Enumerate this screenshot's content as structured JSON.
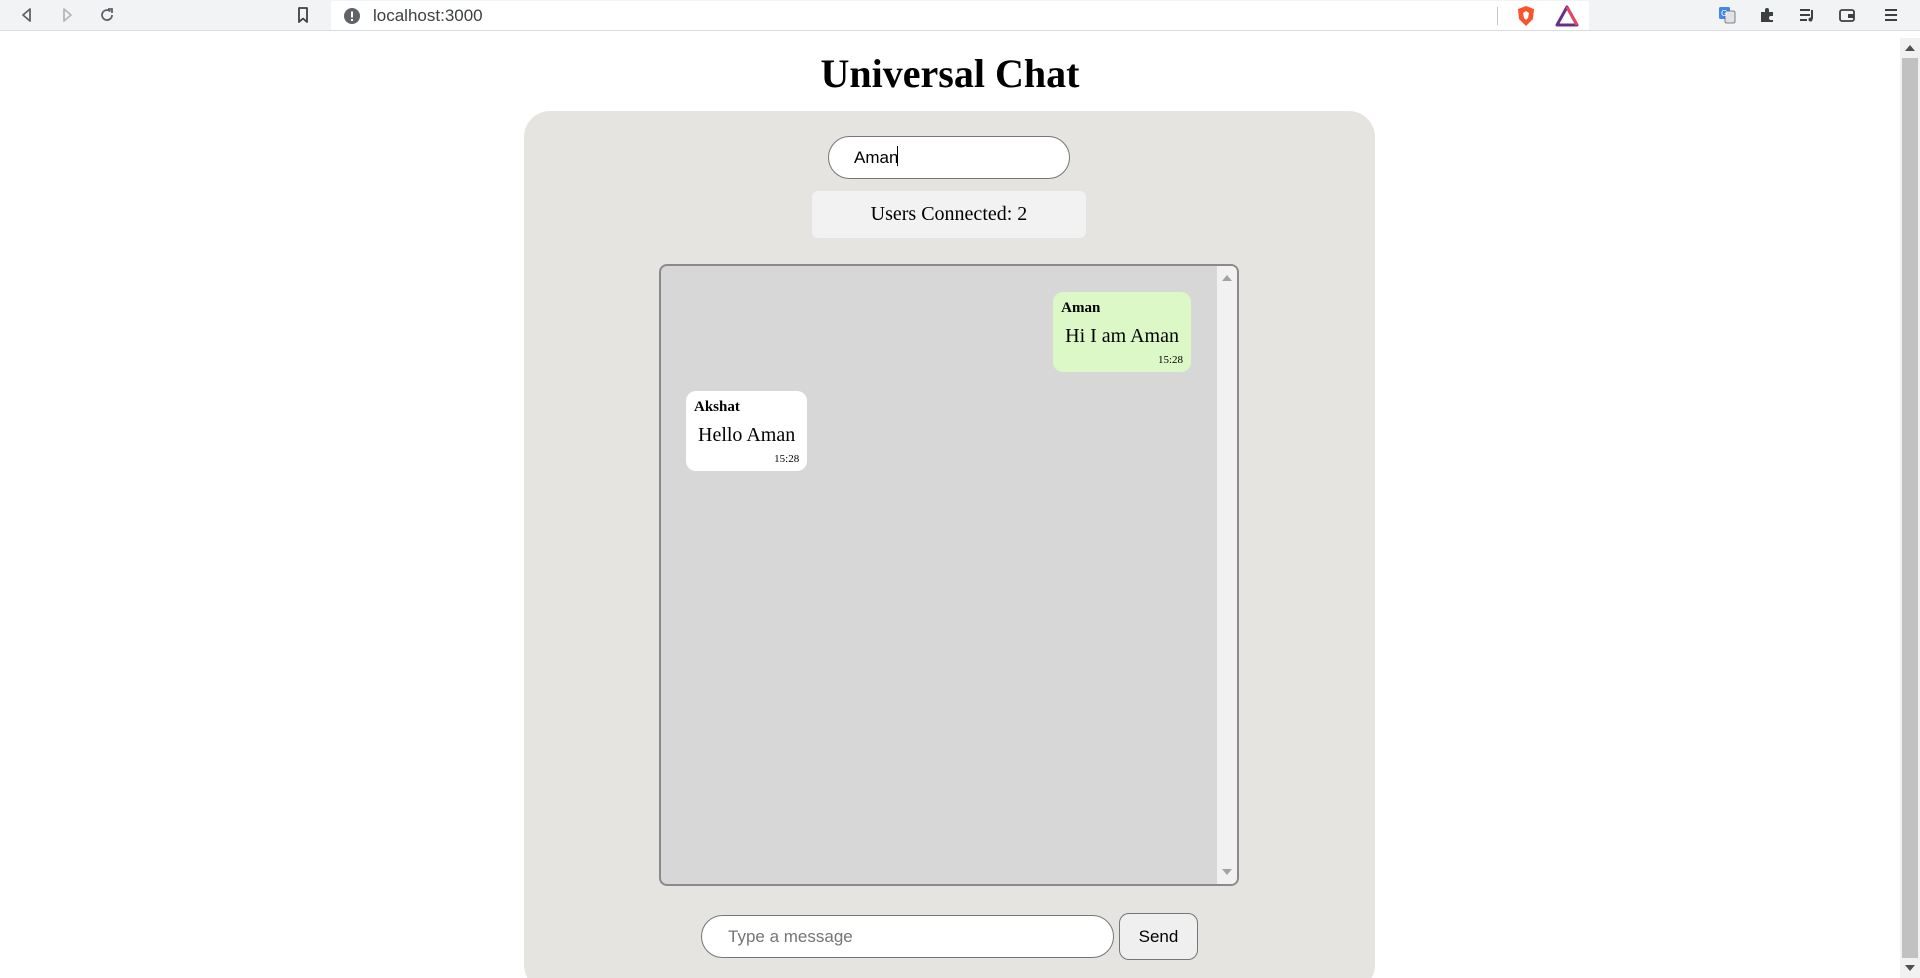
{
  "browser": {
    "url": "localhost:3000",
    "icons": [
      "back-icon",
      "forward-icon",
      "reload-icon",
      "bookmark-icon",
      "site-info-icon",
      "brave-shield-icon",
      "brave-rewards-icon",
      "translate-icon",
      "extensions-icon",
      "media-icon",
      "wallet-icon",
      "menu-icon"
    ]
  },
  "page": {
    "title": "Universal Chat"
  },
  "chat": {
    "name_value": "Aman",
    "users_connected": "Users Connected: 2",
    "messages": [
      {
        "sender": "Aman",
        "text": "Hi I am Aman",
        "time": "15:28",
        "type": "sent"
      },
      {
        "sender": "Akshat",
        "text": "Hello Aman",
        "time": "15:28",
        "type": "received"
      }
    ],
    "input_placeholder": "Type a message",
    "send_label": "Send"
  },
  "colors": {
    "panel_bg": "#e6e4e0",
    "messages_bg": "#d7d7d7",
    "sent_bubble": "#dcf8c6",
    "received_bubble": "#ffffff",
    "users_box": "#f2f2f2"
  }
}
